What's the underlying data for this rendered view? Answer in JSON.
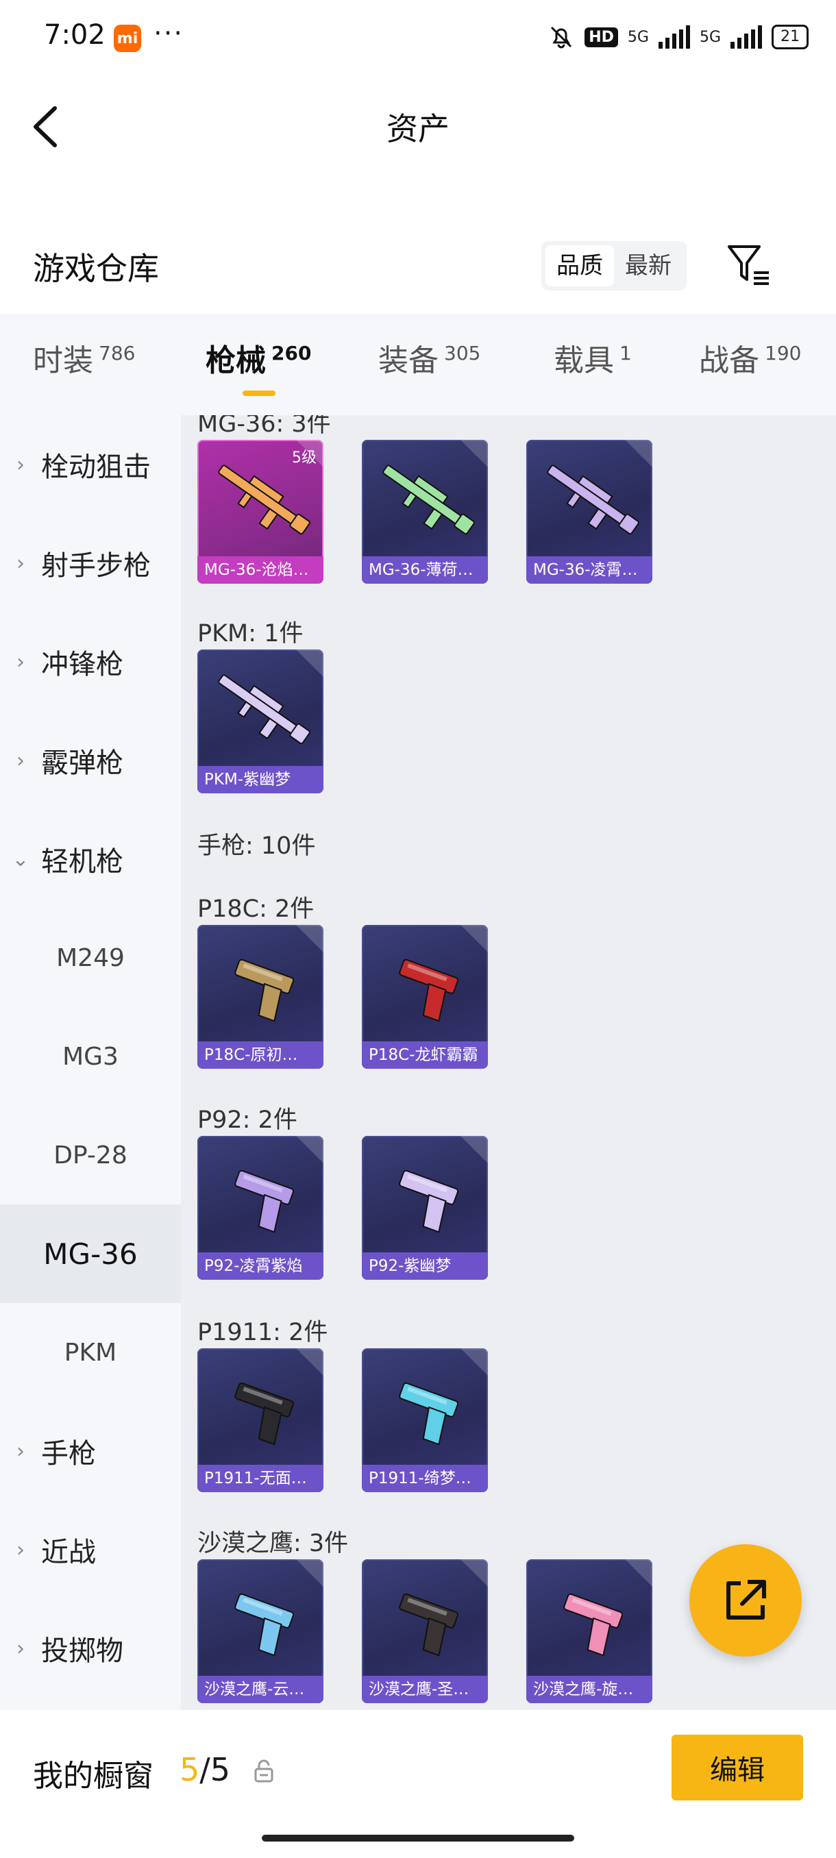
{
  "status_bar": {
    "time": "7:02",
    "app_badge": "mi",
    "dots": "···",
    "hd": "HD",
    "net1": "5G",
    "net2": "5G",
    "battery": "21"
  },
  "header": {
    "title": "资产"
  },
  "section": {
    "title": "游戏仓库",
    "sort_options": [
      "品质",
      "最新"
    ],
    "sort_active": "品质"
  },
  "tabs": [
    {
      "label": "时装",
      "count": "786"
    },
    {
      "label": "枪械",
      "count": "260",
      "active": true
    },
    {
      "label": "装备",
      "count": "305"
    },
    {
      "label": "载具",
      "count": "1"
    },
    {
      "label": "战备",
      "count": "190"
    }
  ],
  "sidebar": [
    {
      "label": "栓动狙击",
      "type": "category",
      "expanded": false
    },
    {
      "label": "射手步枪",
      "type": "category",
      "expanded": false
    },
    {
      "label": "冲锋枪",
      "type": "category",
      "expanded": false
    },
    {
      "label": "霰弹枪",
      "type": "category",
      "expanded": false
    },
    {
      "label": "轻机枪",
      "type": "category",
      "expanded": true
    },
    {
      "label": "M249",
      "type": "sub"
    },
    {
      "label": "MG3",
      "type": "sub"
    },
    {
      "label": "DP-28",
      "type": "sub"
    },
    {
      "label": "MG-36",
      "type": "sub",
      "selected": true
    },
    {
      "label": "PKM",
      "type": "sub"
    },
    {
      "label": "手枪",
      "type": "category",
      "expanded": false
    },
    {
      "label": "近战",
      "type": "category",
      "expanded": false
    },
    {
      "label": "投掷物",
      "type": "category",
      "expanded": false
    }
  ],
  "content": {
    "groups": [
      {
        "header": "MG-36: 3件",
        "items": [
          {
            "name": "MG-36-沧焰…",
            "level": "5级",
            "rarity": "pink",
            "accent": "#f2a95a"
          },
          {
            "name": "MG-36-薄荷…",
            "rarity": "purple",
            "accent": "#9fe3a3"
          },
          {
            "name": "MG-36-凌霄…",
            "rarity": "purple",
            "accent": "#c9b4ee"
          }
        ]
      },
      {
        "header": "PKM: 1件",
        "items": [
          {
            "name": "PKM-紫幽梦",
            "rarity": "purple",
            "accent": "#d9cdf4"
          }
        ]
      },
      {
        "header": "手枪: 10件",
        "items": []
      },
      {
        "header": "P18C: 2件",
        "items": [
          {
            "name": "P18C-原初…",
            "rarity": "purple",
            "accent": "#b99a5c"
          },
          {
            "name": "P18C-龙虾霸霸",
            "rarity": "purple",
            "accent": "#c62a2a"
          }
        ]
      },
      {
        "header": "P92: 2件",
        "items": [
          {
            "name": "P92-凌霄紫焰",
            "rarity": "purple",
            "accent": "#b59be8"
          },
          {
            "name": "P92-紫幽梦",
            "rarity": "purple",
            "accent": "#d2c3f2"
          }
        ]
      },
      {
        "header": "P1911: 2件",
        "items": [
          {
            "name": "P1911-无面…",
            "rarity": "purple",
            "accent": "#2a2a2e"
          },
          {
            "name": "P1911-绮梦…",
            "rarity": "purple",
            "accent": "#5fd0e8"
          }
        ]
      },
      {
        "header": "沙漠之鹰: 3件",
        "items": [
          {
            "name": "沙漠之鹰-云…",
            "rarity": "purple",
            "accent": "#7cc7f0"
          },
          {
            "name": "沙漠之鹰-圣…",
            "rarity": "purple",
            "accent": "#3a3434"
          },
          {
            "name": "沙漠之鹰-旋…",
            "rarity": "purple",
            "accent": "#f08fb8"
          }
        ]
      }
    ]
  },
  "bottom": {
    "showcase_label": "我的橱窗",
    "current": "5",
    "separator": "/",
    "total": "5",
    "edit_label": "编辑"
  },
  "colors": {
    "accent": "#f7b614",
    "card_label": "#6d53c9",
    "card_label_pink": "#c43cc0"
  }
}
